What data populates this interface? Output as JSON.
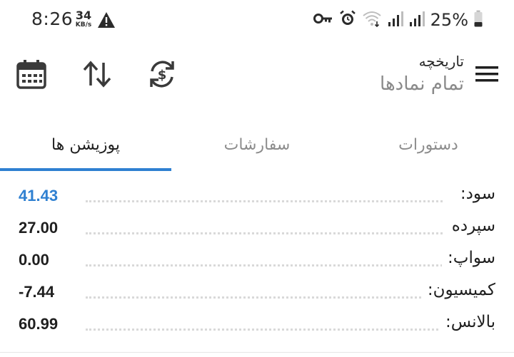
{
  "status_bar": {
    "time": "8:26",
    "net_speed_value": "34",
    "net_speed_unit": "KB/s",
    "battery_percent": "25%",
    "icons": [
      "warning-icon",
      "vpn-key-icon",
      "alarm-icon",
      "wifi-icon",
      "signal-icon",
      "signal-icon",
      "battery-icon"
    ]
  },
  "app_bar": {
    "title": "تاریخچه",
    "subtitle": "تمام نمادها",
    "icons": [
      "calendar-icon",
      "sort-icon",
      "currency-exchange-icon",
      "menu-icon"
    ]
  },
  "tabs": [
    {
      "label": "پوزیشن ها",
      "active": true
    },
    {
      "label": "سفارشات",
      "active": false
    },
    {
      "label": "دستورات",
      "active": false
    }
  ],
  "summary": [
    {
      "label": "سود:",
      "value": "41.43"
    },
    {
      "label": "سپرده",
      "value": "27.00"
    },
    {
      "label": "سواپ:",
      "value": "0.00"
    },
    {
      "label": "کمیسیون:",
      "value": "-7.44"
    },
    {
      "label": "بالانس:",
      "value": "60.99"
    }
  ],
  "colors": {
    "accent": "#2f80d1",
    "text": "#1f1f1f",
    "muted": "#8c8c8c"
  }
}
